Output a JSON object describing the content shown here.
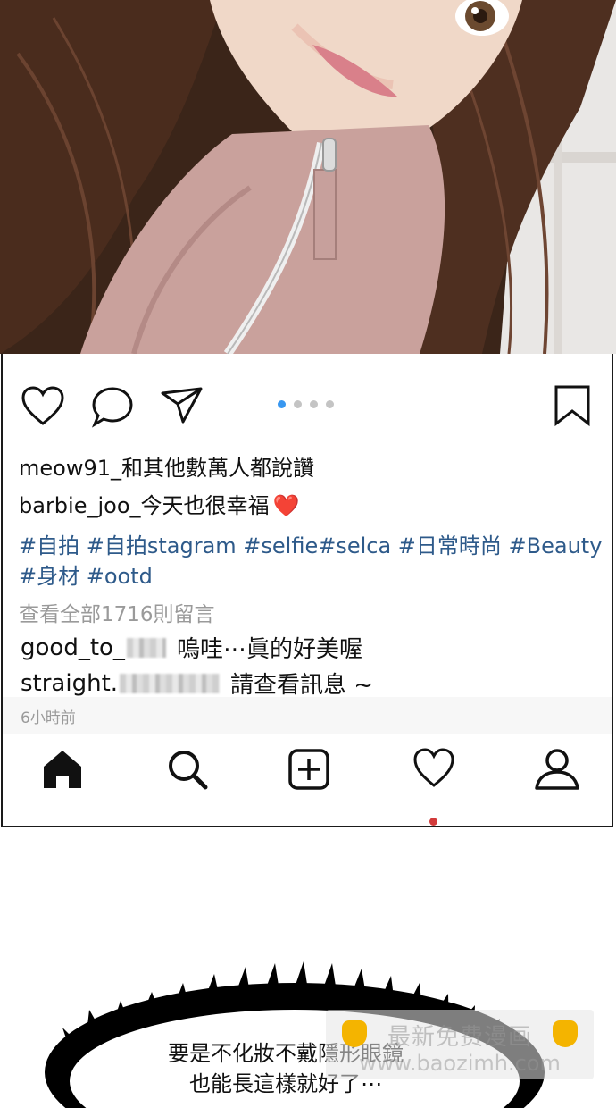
{
  "post": {
    "likes_text": "meow91_和其他數萬人都說讚",
    "caption_text": "barbie_joo_今天也很幸福",
    "caption_emoji": "❤️",
    "hashtags_text": "#自拍 #自拍stagram #selfie#selca #日常時尚 #Beauty #身材 #ootd",
    "view_comments_text": "查看全部1716則留言",
    "comments": [
      {
        "user": "good_to_",
        "text": "嗚哇⋯眞的好美喔"
      },
      {
        "user": "straight.",
        "text": "請查看訊息 ~"
      }
    ],
    "timestamp": "6小時前",
    "carousel": {
      "count": 4,
      "active_index": 0
    }
  },
  "icons": {
    "action_bar": [
      "heart-icon",
      "comment-icon",
      "share-icon",
      "bookmark-icon"
    ],
    "bottom_nav": [
      "home-icon",
      "search-icon",
      "add-post-icon",
      "activity-heart-icon",
      "profile-icon"
    ]
  },
  "colors": {
    "hashtag": "#2e5a8a",
    "carousel_active": "#3897f0",
    "notification_dot": "#d23a3a",
    "heart_emoji": "#e0282e"
  },
  "bubble": {
    "line1": "要是不化妝不戴隱形眼鏡",
    "line2": "也能長這樣就好了⋯"
  },
  "watermark": {
    "line1": "最新免费漫画",
    "line2": "www.baozimh.com"
  }
}
